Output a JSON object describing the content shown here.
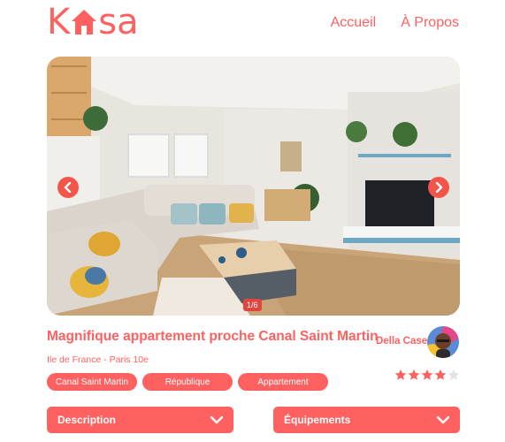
{
  "header": {
    "logo_left": "K",
    "logo_right": "sa",
    "nav": [
      "Accueil",
      "À Propos"
    ]
  },
  "carousel": {
    "counter": "1/6"
  },
  "listing": {
    "title": "Magnifique appartement proche Canal Saint Martin",
    "location": "Ile de France - Paris 10e",
    "host_name": "Della Case",
    "tags": [
      "Canal Saint Martin",
      "République",
      "Appartement"
    ],
    "rating": 4,
    "rating_max": 5
  },
  "collapses": {
    "description": "Description",
    "equipments": "Équipements"
  },
  "colors": {
    "accent": "#ff6060",
    "star_empty": "#e3e3e3"
  },
  "icons": {
    "prev": "chevron-left-icon",
    "next": "chevron-right-icon",
    "collapse": "chevron-down-icon",
    "logo_house": "house-icon",
    "star": "star-icon"
  }
}
